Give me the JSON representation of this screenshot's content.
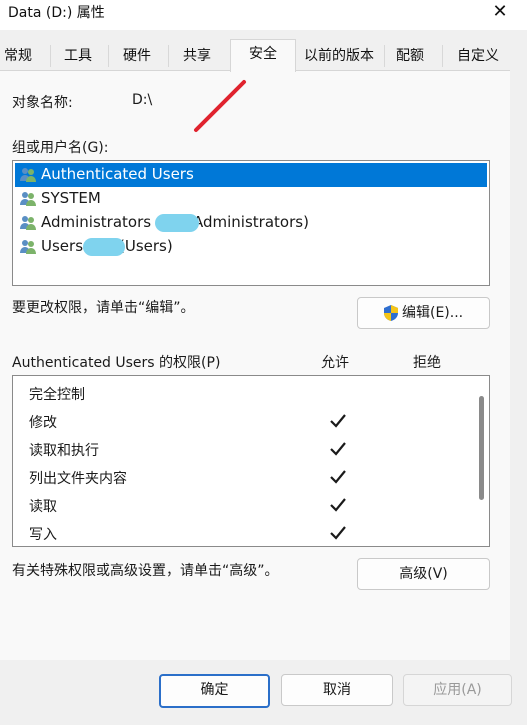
{
  "window": {
    "title": "Data (D:) 属性",
    "close_glyph": "✕"
  },
  "tabs": [
    {
      "label": "常规",
      "active": false
    },
    {
      "label": "工具",
      "active": false
    },
    {
      "label": "硬件",
      "active": false
    },
    {
      "label": "共享",
      "active": false
    },
    {
      "label": "安全",
      "active": true
    },
    {
      "label": "以前的版本",
      "active": false
    },
    {
      "label": "配额",
      "active": false
    },
    {
      "label": "自定义",
      "active": false
    }
  ],
  "object": {
    "label": "对象名称:",
    "value": "D:\\"
  },
  "groups": {
    "label": "组或用户名(G):",
    "items": [
      {
        "name": "Authenticated Users",
        "icon": "users-icon",
        "selected": true
      },
      {
        "name": "SYSTEM",
        "icon": "users-icon",
        "selected": false
      },
      {
        "name": "Administrators (",
        "suffix": "Administrators)",
        "icon": "users-icon",
        "selected": false
      },
      {
        "name": "Users",
        "suffix": "(Users)",
        "icon": "users-icon",
        "selected": false
      }
    ]
  },
  "edit": {
    "hint": "要更改权限，请单击“编辑”。",
    "button": "编辑(E)...",
    "icon": "shield-icon"
  },
  "permissions": {
    "title": "Authenticated Users 的权限(P)",
    "allow_header": "允许",
    "deny_header": "拒绝",
    "rows": [
      {
        "name": "完全控制",
        "allow": false,
        "deny": false
      },
      {
        "name": "修改",
        "allow": true,
        "deny": false
      },
      {
        "name": "读取和执行",
        "allow": true,
        "deny": false
      },
      {
        "name": "列出文件夹内容",
        "allow": true,
        "deny": false
      },
      {
        "name": "读取",
        "allow": true,
        "deny": false
      },
      {
        "name": "写入",
        "allow": true,
        "deny": false
      }
    ]
  },
  "advanced": {
    "hint": "有关特殊权限或高级设置，请单击“高级”。",
    "button": "高级(V)"
  },
  "footer": {
    "ok": "确定",
    "cancel": "取消",
    "apply": "应用(A)"
  },
  "colors": {
    "selection": "#0078d7",
    "annotation": "#e0232e",
    "redaction": "#7fd3ee"
  }
}
